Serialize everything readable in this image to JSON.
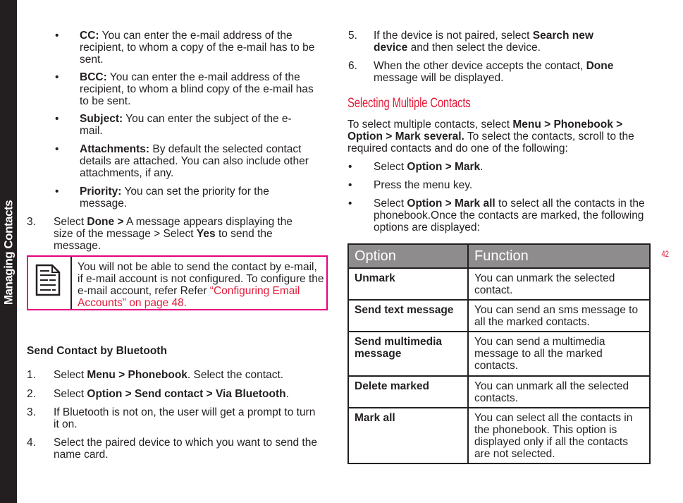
{
  "sidebar": {
    "label": "Managing Contacts"
  },
  "page_number": "42",
  "left": {
    "bullets": [
      {
        "label": "CC:",
        "text": " You can enter the e-mail address of the recipient, to whom a copy of the e-mail has to be sent."
      },
      {
        "label": "BCC:",
        "text": " You can enter the e-mail address of the recipient, to whom a blind copy of the e-mail has to be sent."
      },
      {
        "label": "Subject:",
        "text": " You can enter the subject of the e-mail."
      },
      {
        "label": "Attachments:",
        "text": " By default the selected contact details are attached. You can also include other attachments, if any."
      },
      {
        "label": "Priority:",
        "text": " You can set the priority for the message."
      }
    ],
    "step3": {
      "num": "3.",
      "a": "Select ",
      "b": "Done >",
      "c": " A message appears displaying the size of the message > Select ",
      "d": "Yes",
      "e": " to send the message."
    },
    "note": {
      "text": "You will not be able to send the contact by e-mail, if e-mail account is not configured. To configure the e-mail account, refer Refer ",
      "link": "“Configuring Email Accounts” on page 48."
    },
    "bt_heading": "Send Contact by Bluetooth",
    "bt_steps": [
      {
        "num": "1.",
        "a": "Select ",
        "b": "Menu > Phonebook",
        "c": ". Select the contact."
      },
      {
        "num": "2.",
        "a": "Select ",
        "b": "Option > Send contact > Via Bluetooth",
        "c": "."
      },
      {
        "num": "3.",
        "a": "If Bluetooth is not on, the user will get a prompt to turn it on.",
        "b": "",
        "c": ""
      },
      {
        "num": "4.",
        "a": "Select the paired device to which you want to send the name card.",
        "b": "",
        "c": ""
      }
    ]
  },
  "right": {
    "steps": [
      {
        "num": "5.",
        "a": "If the device is not paired, select ",
        "b": "Search new device",
        "c": " and then select the device."
      },
      {
        "num": "6.",
        "a": "When the other device accepts the contact, ",
        "b": "Done",
        "c": " message will be displayed."
      }
    ],
    "heading": "Selecting Multiple Contacts",
    "intro": {
      "a": "To select multiple contacts, select ",
      "b": "Menu > Phonebook > Option > Mark several.",
      "c": " To select the contacts, scroll to the required contacts and do one of the following:"
    },
    "bullets": [
      {
        "a": "Select ",
        "b": "Option > Mark",
        "c": "."
      },
      {
        "a": "Press the menu key.",
        "b": "",
        "c": ""
      },
      {
        "a": "Select ",
        "b": "Option > Mark all",
        "c": " to select all the contacts in the phonebook.Once the contacts are marked, the following options are displayed:"
      }
    ],
    "table": {
      "headers": [
        "Option",
        "Function"
      ],
      "rows": [
        [
          "Unmark",
          "You can unmark the selected contact."
        ],
        [
          "Send text message",
          "You can send an sms message to all the marked contacts."
        ],
        [
          "Send multimedia message",
          "You can send a multimedia message to all the marked contacts."
        ],
        [
          "Delete marked",
          "You can unmark all the selected contacts."
        ],
        [
          "Mark all",
          "You can select all the contacts in the phonebook. This option is displayed only if all the contacts are not selected."
        ]
      ]
    }
  },
  "colors": {
    "accent": "#e31937",
    "note_border": "#e5007e",
    "sidebar": "#231f20",
    "table_header": "#8e8c8c"
  }
}
